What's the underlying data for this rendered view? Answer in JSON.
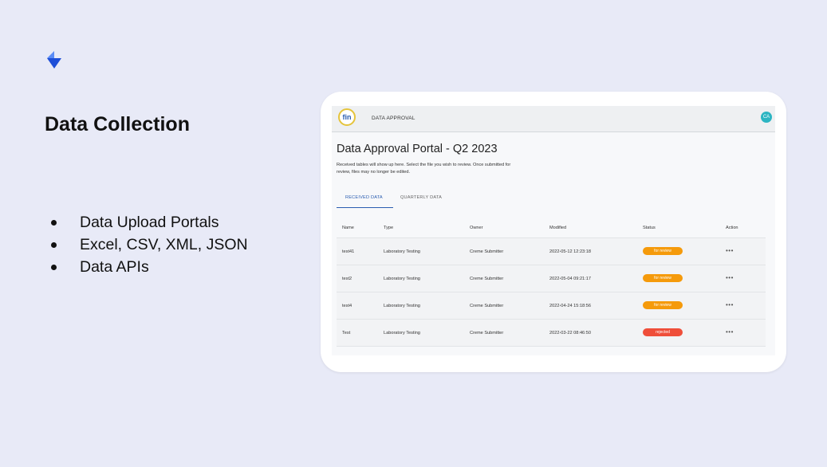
{
  "slide": {
    "title": "Data Collection",
    "logo_icon": "blue-arrow-logo-icon",
    "bullets": [
      "Data Upload Portals",
      "Excel, CSV, XML, JSON",
      "Data APIs"
    ]
  },
  "app": {
    "logo_text": "fin",
    "nav_label": "DATA APPROVAL",
    "avatar_initials": "CA",
    "portal_title": "Data Approval Portal - Q2 2023",
    "portal_description": "Received tables will show up here. Select the file you wish to review. Once submitted for review, files may no longer be edited.",
    "tabs": [
      {
        "label": "RECEIVED DATA",
        "active": true
      },
      {
        "label": "QUARTERLY DATA",
        "active": false
      }
    ],
    "table": {
      "headers": [
        "Name",
        "Type",
        "Owner",
        "Modified",
        "Status",
        "Action"
      ],
      "rows": [
        {
          "name": "test41",
          "type": "Laboratory Testing",
          "owner": "Creme Submitter",
          "modified": "2022-05-12 12:23:18",
          "status": "for review",
          "status_color": "#f59a0b",
          "action": "•••"
        },
        {
          "name": "test2",
          "type": "Laboratory Testing",
          "owner": "Creme Submitter",
          "modified": "2022-05-04 09:21:17",
          "status": "for review",
          "status_color": "#f59a0b",
          "action": "•••"
        },
        {
          "name": "test4",
          "type": "Laboratory Testing",
          "owner": "Creme Submitter",
          "modified": "2022-04-24 15:18:56",
          "status": "for review",
          "status_color": "#f59a0b",
          "action": "•••"
        },
        {
          "name": "Test",
          "type": "Laboratory Testing",
          "owner": "Creme Submitter",
          "modified": "2022-03-22 08:46:50",
          "status": "rejected",
          "status_color": "#ef4e3a",
          "action": "•••"
        }
      ]
    }
  },
  "colors": {
    "background": "#e8eaf7",
    "accent": "#2a5db0",
    "logo_blue": "#1e4fd8"
  }
}
